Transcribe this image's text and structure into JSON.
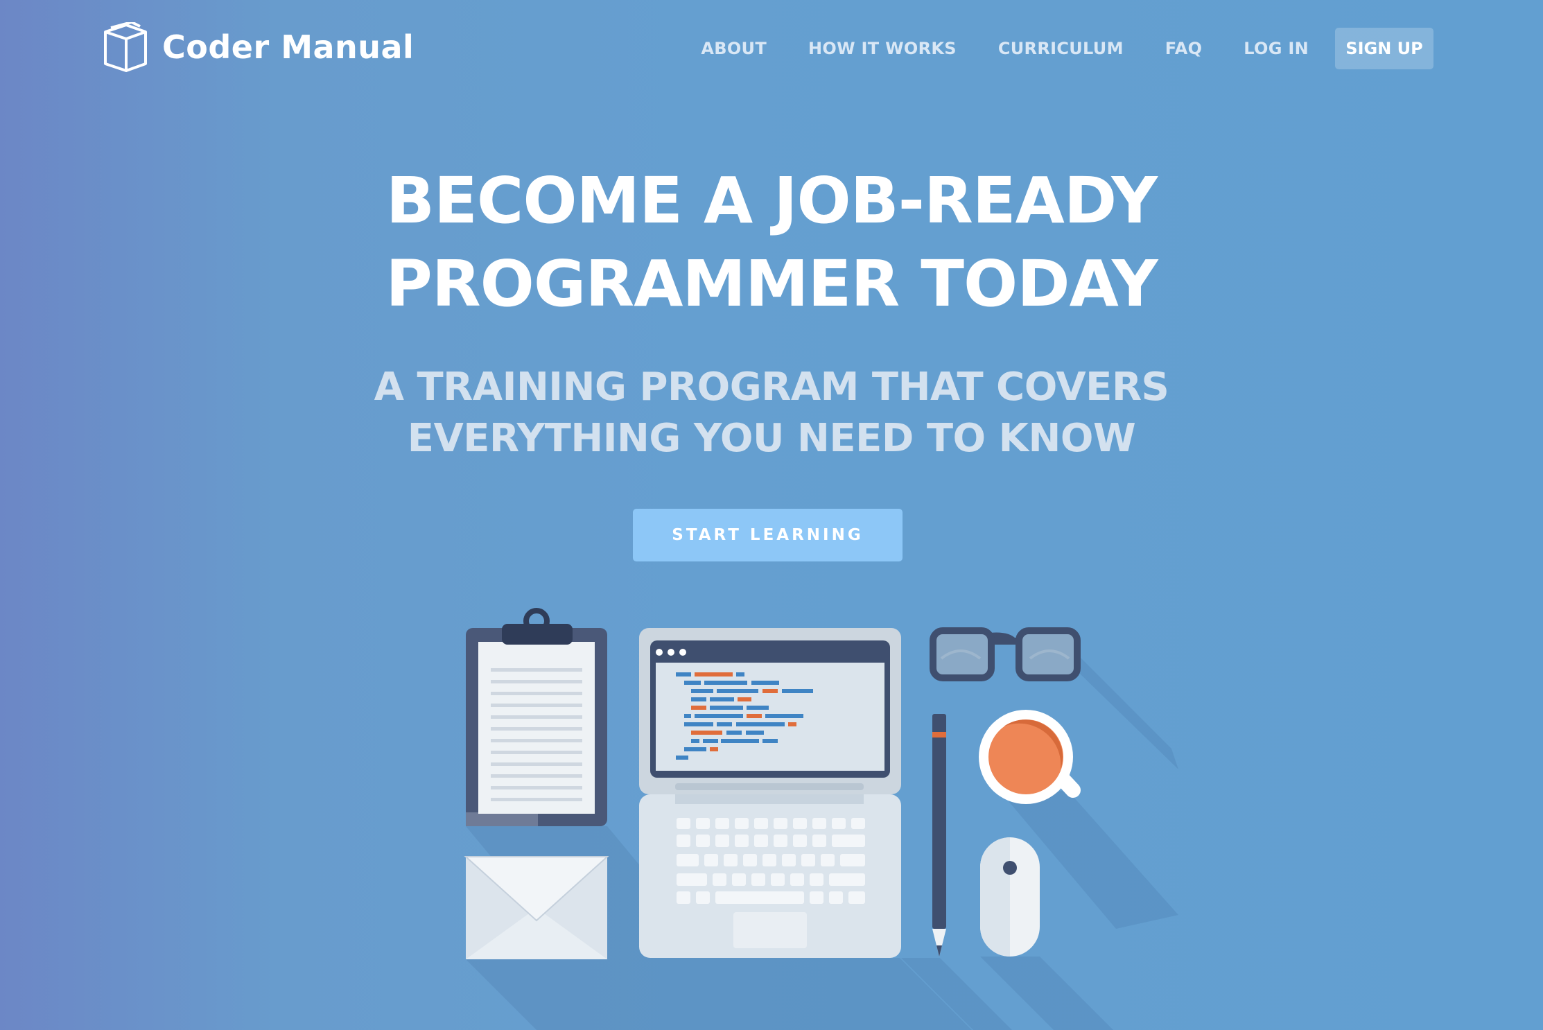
{
  "brand": {
    "name": "Coder Manual",
    "icon": "open-book-icon"
  },
  "nav": {
    "items": [
      "ABOUT",
      "HOW IT WORKS",
      "CURRICULUM",
      "FAQ",
      "LOG IN"
    ],
    "signup_label": "SIGN UP"
  },
  "hero": {
    "title_line1": "BECOME A JOB-READY",
    "title_line2": "PROGRAMMER TODAY",
    "subtitle_line1": "A TRAINING PROGRAM THAT COVERS",
    "subtitle_line2": "EVERYTHING YOU NEED TO KNOW",
    "cta_label": "START LEARNING"
  },
  "illustration": {
    "items": [
      "clipboard-icon",
      "laptop-icon",
      "glasses-icon",
      "pencil-icon",
      "coffee-cup-icon",
      "mouse-icon",
      "envelope-icon"
    ]
  },
  "colors": {
    "background": "#629fd1",
    "cta": "#8dc7f7",
    "accent_orange": "#ee8656",
    "dark_navy": "#3f4f6f"
  }
}
